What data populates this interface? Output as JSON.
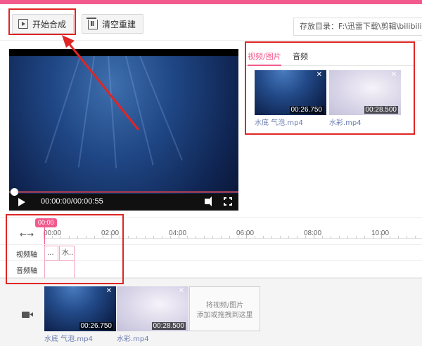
{
  "toolbar": {
    "start_label": "开始合成",
    "clear_label": "清空重建",
    "save_path": "存放目录：F:\\迅雷下载\\剪辑\\bilibili"
  },
  "player": {
    "time": "00:00:00/00:00:55"
  },
  "media": {
    "tabs": [
      {
        "label": "视频/图片",
        "active": true
      },
      {
        "label": "音频",
        "active": false
      }
    ],
    "items": [
      {
        "name": "水底  气泡.mp4",
        "duration": "00:26.750"
      },
      {
        "name": "水彩.mp4",
        "duration": "00:28.500"
      }
    ]
  },
  "timeline": {
    "playhead": "00:00",
    "ticks": [
      "00:00",
      "02:00",
      "04:00",
      "06:00",
      "08:00",
      "10:00"
    ],
    "tracks": [
      {
        "label": "视频轴",
        "clips": [
          "...",
          "水..."
        ]
      },
      {
        "label": "音频轴",
        "clips": []
      }
    ]
  },
  "bottom": {
    "clips": [
      {
        "name": "水底  气泡.mp4",
        "duration": "00:26.750"
      },
      {
        "name": "水彩.mp4",
        "duration": "00:28.500"
      }
    ],
    "drop_line1": "将视频/图片",
    "drop_line2": "添加或拖拽到这里"
  },
  "colors": {
    "accent": "#f25a8e",
    "annotation": "#e02525"
  }
}
